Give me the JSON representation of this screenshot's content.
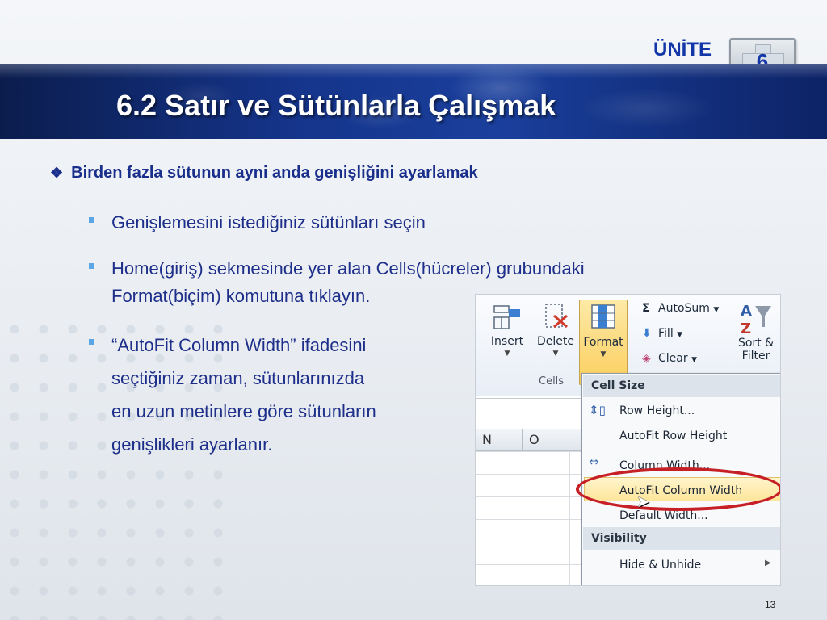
{
  "header": {
    "unit_label": "ÜNİTE",
    "unit_number": "6",
    "title": "6.2 Satır ve Sütünlarla Çalışmak"
  },
  "content": {
    "main_bullet": "Birden fazla sütunun ayni anda genişliğini ayarlamak",
    "sub_bullets": [
      {
        "lines": [
          "Genişlemesini istediğiniz sütünları seçin"
        ]
      },
      {
        "lines": [
          "Home(giriş) sekmesinde yer alan Cells(hücreler) grubundaki",
          "Format(biçim) komutuna tıklayın."
        ]
      },
      {
        "lines": [
          "“AutoFit Column Width” ifadesini",
          "seçtiğiniz zaman, sütunlarınızda",
          "en uzun metinlere göre sütunların",
          "genişlikleri ayarlanır."
        ]
      }
    ]
  },
  "excel": {
    "ribbon": {
      "insert": "Insert",
      "delete": "Delete",
      "format": "Format",
      "group_label": "Cells",
      "autosum": "AutoSum",
      "fill": "Fill",
      "clear": "Clear",
      "sort_filter_1": "Sort &",
      "sort_filter_2": "Filter"
    },
    "columns": [
      "N",
      "O"
    ],
    "menu": {
      "cell_size": "Cell Size",
      "row_height": "Row Height...",
      "autofit_row_height": "AutoFit Row Height",
      "column_width": "Column Width...",
      "autofit_column_width": "AutoFit Column Width",
      "default_width": "Default Width...",
      "visibility": "Visibility",
      "hide_unhide": "Hide & Unhide"
    }
  },
  "footer": {
    "page_number": "13"
  },
  "colors": {
    "title_blue": "#1a2f8c",
    "banner": "#15348a",
    "bullet_square": "#5aa6e6",
    "highlight_oval": "#c62026"
  }
}
